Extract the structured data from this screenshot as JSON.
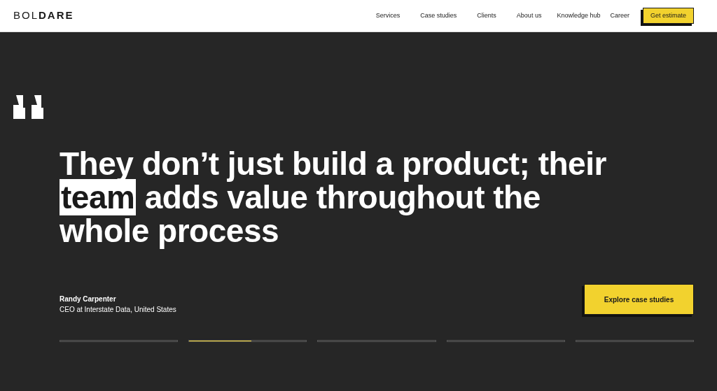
{
  "header": {
    "logo": "BOL**DARE**",
    "nav": [
      "Services",
      "Case studies",
      "Clients",
      "About us",
      "Knowledge hub",
      "Career"
    ],
    "cta": "Get estimate"
  },
  "testimonial": {
    "quote": [
      {
        "text": "They don’t just build a product; their ",
        "highlight": false
      },
      {
        "text": "team",
        "highlight": true
      },
      {
        "text": " adds value throughout the whole process",
        "highlight": false
      }
    ],
    "author": "Randy Carpenter",
    "role": "CEO at Interstate Data, United States"
  },
  "button": "Explore case studies",
  "slides": [
    {
      "level": 0
    },
    {
      "level": 0.53
    },
    {
      "level": 0
    },
    {
      "level": 0
    },
    {
      "level": 0
    }
  ]
}
